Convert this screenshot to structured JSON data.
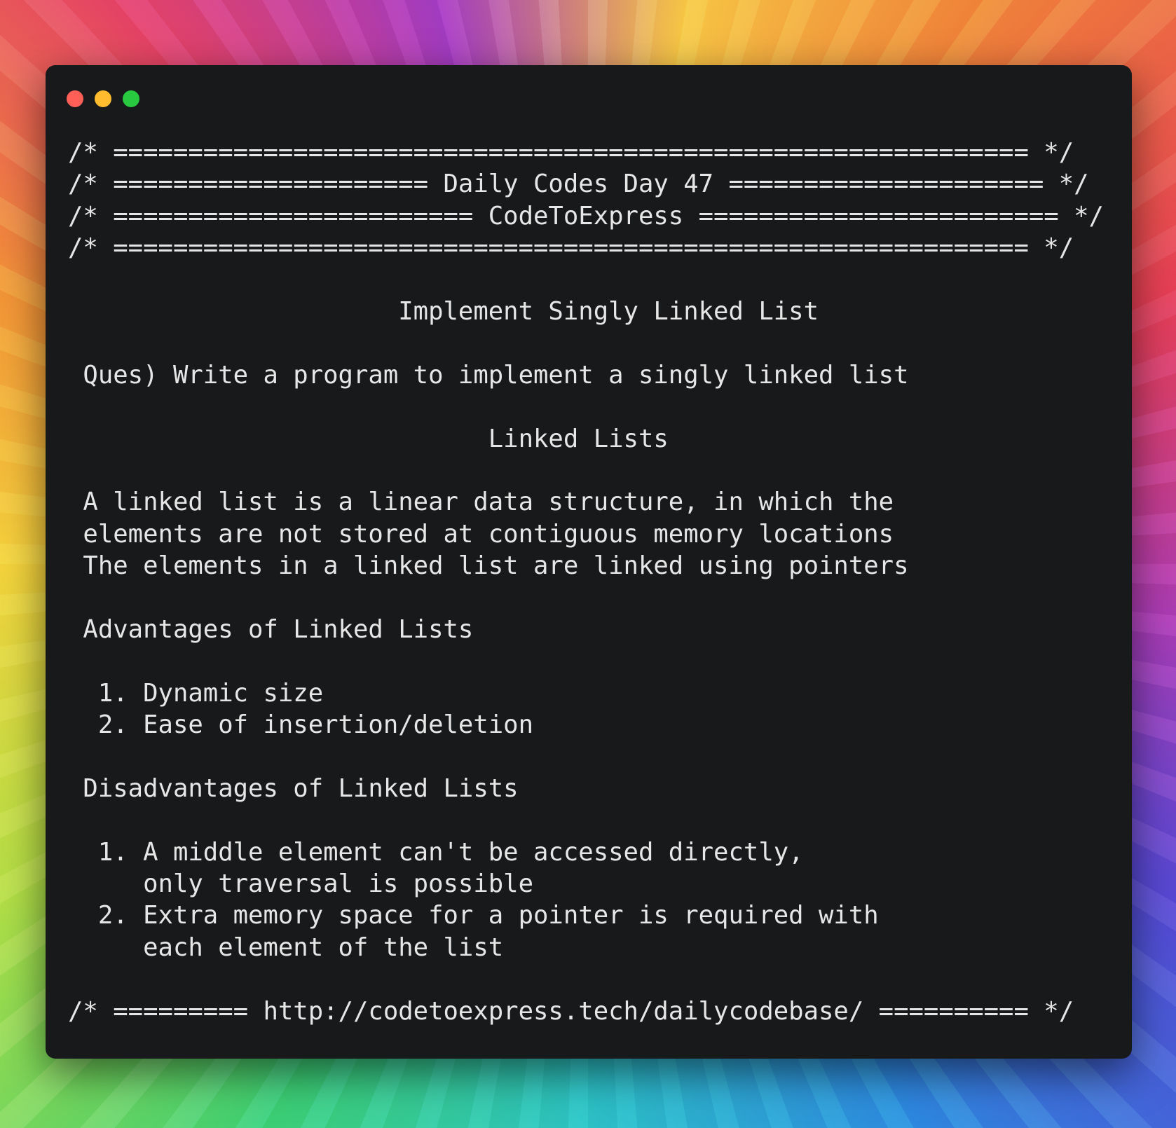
{
  "window": {
    "controls": [
      "close",
      "minimize",
      "maximize"
    ],
    "colors": {
      "background": "#18191b",
      "text": "#e6e6e6",
      "close": "#ff5f57",
      "minimize": "#febc2e",
      "maximize": "#28c840"
    }
  },
  "code_lines": [
    "/* ============================================================= */",
    "/* ===================== Daily Codes Day 47 ===================== */",
    "/* ======================== CodeToExpress ======================== */",
    "/* ============================================================= */",
    "",
    "                      Implement Singly Linked List",
    "",
    " Ques) Write a program to implement a singly linked list",
    "",
    "                            Linked Lists",
    "",
    " A linked list is a linear data structure, in which the",
    " elements are not stored at contiguous memory locations",
    " The elements in a linked list are linked using pointers",
    "",
    " Advantages of Linked Lists",
    "",
    "  1. Dynamic size",
    "  2. Ease of insertion/deletion",
    "",
    " Disadvantages of Linked Lists",
    "",
    "  1. A middle element can't be accessed directly,",
    "     only traversal is possible",
    "  2. Extra memory space for a pointer is required with",
    "     each element of the list",
    "",
    "/* ========= http://codetoexpress.tech/dailycodebase/ ========== */"
  ]
}
